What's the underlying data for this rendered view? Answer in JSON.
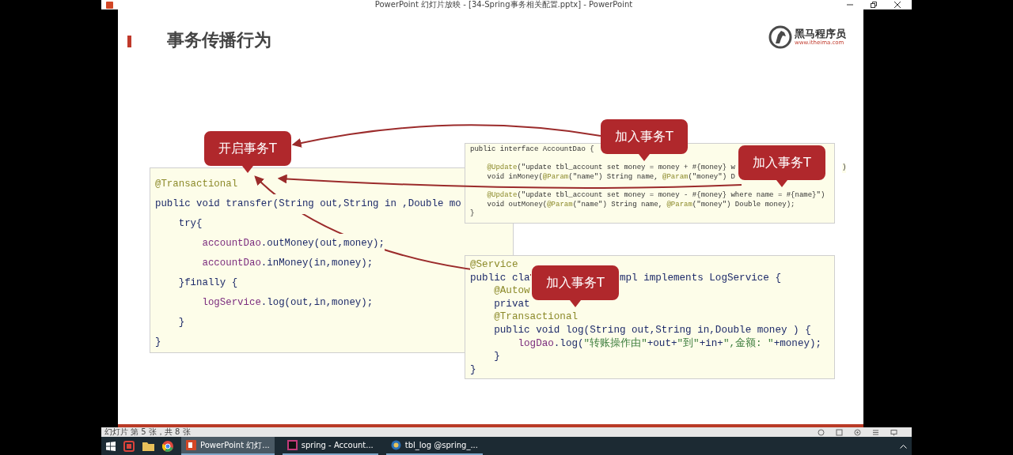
{
  "window": {
    "title": "PowerPoint 幻灯片放映 - [34-Spring事务相关配置.pptx] - PowerPoint"
  },
  "slide": {
    "title": "事务传播行为",
    "logo": {
      "name": "黑马程序员",
      "url": "www.itheima.com"
    },
    "code_blocks": [
      {
        "kind": "transfer",
        "lines": [
          {
            "kind": "code",
            "parts": [
              [
                {
                  "text": "@Transactional",
                  "kind": "annotation"
                }
              ]
            ]
          },
          {
            "kind": "code",
            "parts": [
              [
                {
                  "text": "public void transfer(String out,String in ,Double mo",
                  "kind": "plain"
                }
              ]
            ]
          },
          {
            "kind": "code",
            "parts": [
              [
                {
                  "text": "    try{",
                  "kind": "plain"
                }
              ]
            ]
          },
          {
            "kind": "code",
            "parts": [
              [
                {
                  "text": "        accountDao",
                  "kind": "member"
                },
                {
                  "text": ".outMoney(out,money);",
                  "kind": "plain"
                }
              ]
            ]
          },
          {
            "kind": "code",
            "parts": [
              [
                {
                  "text": "        accountDao",
                  "kind": "member"
                },
                {
                  "text": ".inMoney(in,money);",
                  "kind": "plain"
                }
              ]
            ]
          },
          {
            "kind": "code",
            "parts": [
              [
                {
                  "text": "    }finally {",
                  "kind": "plain"
                }
              ]
            ]
          },
          {
            "kind": "code",
            "parts": [
              [
                {
                  "text": "        logService",
                  "kind": "member"
                },
                {
                  "text": ".log(out,in,money);",
                  "kind": "plain"
                }
              ]
            ]
          },
          {
            "kind": "code",
            "parts": [
              [
                {
                  "text": "    }",
                  "kind": "plain"
                }
              ]
            ]
          },
          {
            "kind": "code",
            "parts": [
              [
                {
                  "text": "}",
                  "kind": "plain"
                }
              ]
            ]
          }
        ]
      },
      {
        "kind": "dao",
        "lines": [
          {
            "kind": "code",
            "parts": [
              [
                {
                  "text": "public interface AccountDao {",
                  "kind": "plain"
                }
              ]
            ]
          },
          {
            "kind": "blank"
          },
          {
            "kind": "code",
            "parts": [
              [
                {
                  "text": "    @Update",
                  "kind": "annotation"
                },
                {
                  "text": "(\"update tbl_account set money = money + #{money} w",
                  "kind": "plain"
                }
              ],
              [
                {
                  "text": ")",
                  "kind": "plain"
                }
              ]
            ]
          },
          {
            "kind": "code",
            "parts": [
              [
                {
                  "text": "    void inMoney(",
                  "kind": "plain"
                },
                {
                  "text": "@Param",
                  "kind": "annotation"
                },
                {
                  "text": "(\"name\") String name, ",
                  "kind": "plain"
                },
                {
                  "text": "@Param",
                  "kind": "annotation"
                },
                {
                  "text": "(\"money\") D",
                  "kind": "plain"
                }
              ]
            ]
          },
          {
            "kind": "blank"
          },
          {
            "kind": "code",
            "parts": [
              [
                {
                  "text": "    @Update",
                  "kind": "annotation"
                },
                {
                  "text": "(\"update tbl_account set money = money - #{money} where name = #{name}\")",
                  "kind": "plain"
                }
              ]
            ]
          },
          {
            "kind": "code",
            "parts": [
              [
                {
                  "text": "    void outMoney(",
                  "kind": "plain"
                },
                {
                  "text": "@Param",
                  "kind": "annotation"
                },
                {
                  "text": "(\"name\") String name, ",
                  "kind": "plain"
                },
                {
                  "text": "@Param",
                  "kind": "annotation"
                },
                {
                  "text": "(\"money\") Double money);",
                  "kind": "plain"
                }
              ]
            ]
          },
          {
            "kind": "code",
            "parts": [
              [
                {
                  "text": "}",
                  "kind": "plain"
                }
              ]
            ]
          }
        ]
      },
      {
        "kind": "service",
        "lines": [
          {
            "kind": "code",
            "parts": [
              [
                {
                  "text": "@Service",
                  "kind": "annotation"
                }
              ]
            ]
          },
          {
            "kind": "code",
            "parts": [
              [
                {
                  "text": "public cla",
                  "kind": "plain"
                }
              ],
              [
                {
                  "text": "mpl implements LogService {",
                  "kind": "plain"
                }
              ]
            ]
          },
          {
            "kind": "code",
            "parts": [
              [
                {
                  "text": "    @Autow",
                  "kind": "annotation"
                }
              ]
            ]
          },
          {
            "kind": "code",
            "parts": [
              [
                {
                  "text": "    privat",
                  "kind": "plain"
                }
              ]
            ]
          },
          {
            "kind": "code",
            "parts": [
              [
                {
                  "text": "    @Transactional",
                  "kind": "annotation"
                }
              ]
            ]
          },
          {
            "kind": "code",
            "parts": [
              [
                {
                  "text": "    public void log(String out,String in,Double money ) {",
                  "kind": "plain"
                }
              ]
            ]
          },
          {
            "kind": "code",
            "parts": [
              [
                {
                  "text": "        logDao",
                  "kind": "member"
                },
                {
                  "text": ".log(",
                  "kind": "plain"
                },
                {
                  "text": "\"转账操作由\"",
                  "kind": "string"
                },
                {
                  "text": "+out+",
                  "kind": "plain"
                },
                {
                  "text": "\"到\"",
                  "kind": "string"
                },
                {
                  "text": "+in+",
                  "kind": "plain"
                },
                {
                  "text": "\",金额: \"",
                  "kind": "string"
                },
                {
                  "text": "+money);",
                  "kind": "plain"
                }
              ]
            ]
          },
          {
            "kind": "code",
            "parts": [
              [
                {
                  "text": "    }",
                  "kind": "plain"
                }
              ]
            ]
          },
          {
            "kind": "code",
            "parts": [
              [
                {
                  "text": "}",
                  "kind": "plain"
                }
              ]
            ]
          }
        ]
      }
    ],
    "callouts": [
      {
        "kind": "start",
        "text": "开启事务T"
      },
      {
        "kind": "join_dao_top",
        "text": "加入事务T"
      },
      {
        "kind": "join_dao_right",
        "text": "加入事务T"
      },
      {
        "kind": "join_service",
        "text": "加入事务T"
      }
    ]
  },
  "status_bar": {
    "text": "幻灯片 第 5 张，共 8 张"
  },
  "taskbar": {
    "items": [
      {
        "kind": "ppt",
        "label": "PowerPoint 幻灯...",
        "selected": true
      },
      {
        "kind": "idea",
        "label": "spring - Account...",
        "selected": false
      },
      {
        "kind": "db",
        "label": "tbl_log @spring_...",
        "selected": false
      }
    ]
  }
}
